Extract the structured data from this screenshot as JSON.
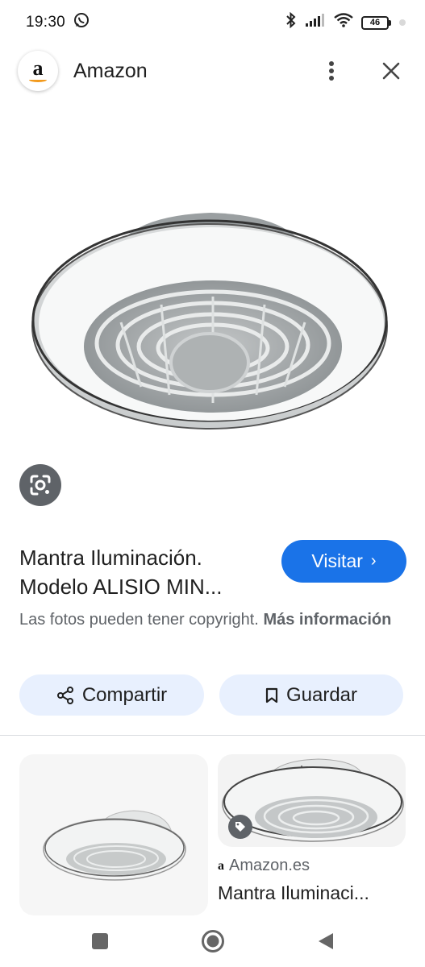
{
  "status_bar": {
    "time": "19:30",
    "battery": "46"
  },
  "header": {
    "site_name": "Amazon",
    "logo_letter": "a"
  },
  "product": {
    "title_line1": "Mantra Iluminación.",
    "title_line2": "Modelo ALISIO MIN...",
    "visit_label": "Visitar",
    "visit_chevron": "›",
    "copyright_text": "Las fotos pueden tener copyright.",
    "more_info_label": "Más información"
  },
  "actions": {
    "share_label": "Compartir",
    "save_label": "Guardar"
  },
  "related": {
    "source_name": "Amazon.es",
    "result_title": "Mantra Iluminaci..."
  },
  "colors": {
    "accent": "#1a73e8",
    "chip_background": "#e8f0fe",
    "secondary_text": "#5f6368"
  }
}
